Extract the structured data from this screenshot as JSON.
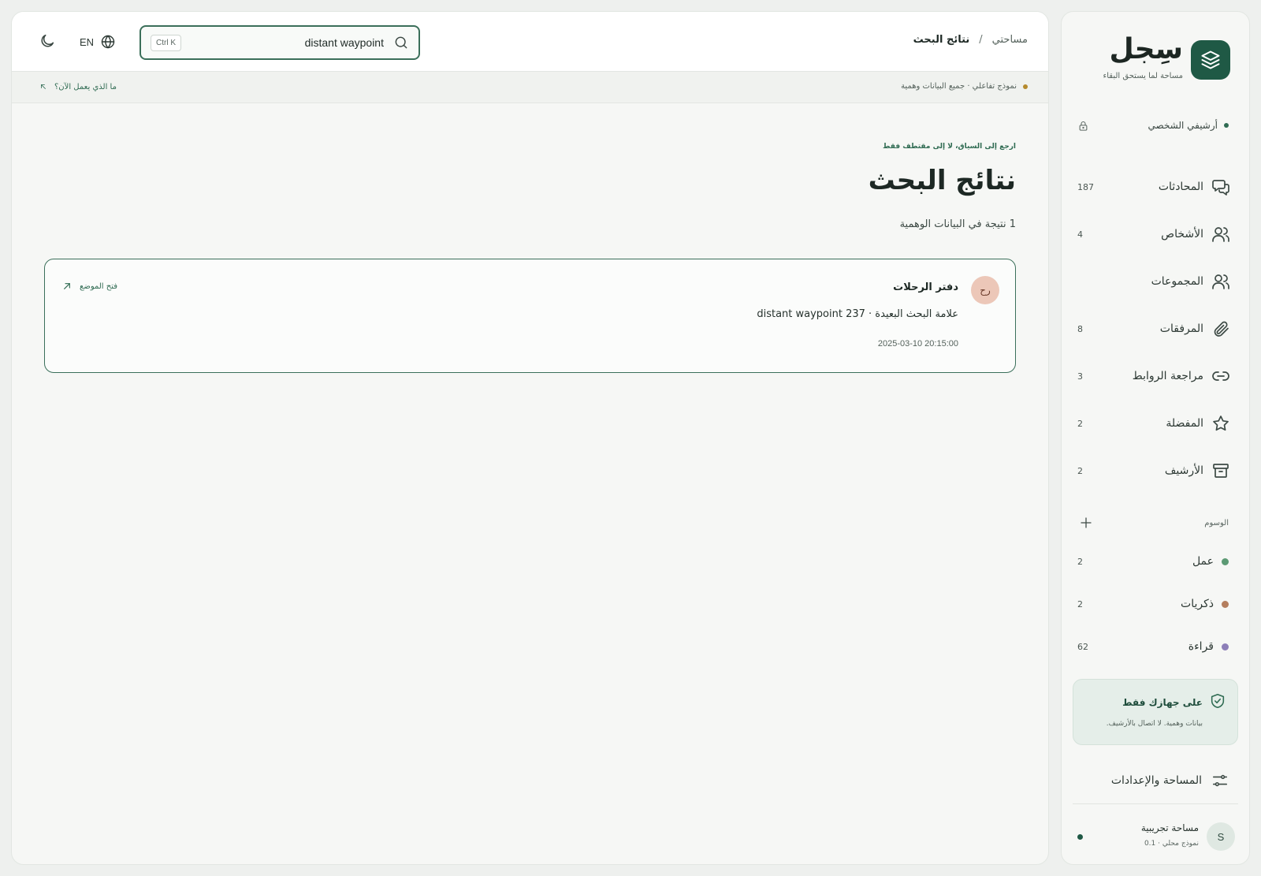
{
  "brand": {
    "name": "سِجل",
    "tagline": "مساحة لما يستحق البقاء"
  },
  "archive": {
    "label": "أرشيفي الشخصي"
  },
  "nav": [
    {
      "label": "المحادثات",
      "count": "187",
      "icon": "chat-icon"
    },
    {
      "label": "الأشخاص",
      "count": "4",
      "icon": "person-icon"
    },
    {
      "label": "المجموعات",
      "count": "",
      "icon": "users-icon"
    },
    {
      "label": "المرفقات",
      "count": "8",
      "icon": "paperclip-icon"
    },
    {
      "label": "مراجعة الروابط",
      "count": "3",
      "icon": "link-icon"
    },
    {
      "label": "المفضلة",
      "count": "2",
      "icon": "star-icon"
    },
    {
      "label": "الأرشيف",
      "count": "2",
      "icon": "archive-box-icon"
    }
  ],
  "tags": {
    "heading": "الوسوم",
    "items": [
      {
        "label": "عمل",
        "count": "2",
        "color": "#5c9a74"
      },
      {
        "label": "ذكريات",
        "count": "2",
        "color": "#b47e5e"
      },
      {
        "label": "قراءة",
        "count": "62",
        "color": "#8d7fb8"
      }
    ]
  },
  "device_card": {
    "title": "على جهازك فقط",
    "subtitle": "بيانات وهمية. لا اتصال بالأرشيف."
  },
  "settings": {
    "label": "المساحة والإعدادات"
  },
  "workspace": {
    "initial": "S",
    "name": "مساحة تجريبية",
    "sub": "نموذج محلي · 0.1"
  },
  "topbar": {
    "breadcrumb_root": "مساحتي",
    "breadcrumb_sep": "/",
    "breadcrumb_current": "نتائج البحث",
    "search_value": "distant waypoint",
    "search_shortcut": "Ctrl K",
    "lang": "EN"
  },
  "notice": {
    "text": "نموذج تفاعلي · جميع البيانات وهمية",
    "link": "ما الذي يعمل الآن؟"
  },
  "results": {
    "context_link": "ارجع إلى السياق، لا إلى مقتطف فقط",
    "title": "نتائج البحث",
    "count_text": "1 نتيجة في البيانات الوهمية",
    "items": [
      {
        "avatar": "رح",
        "title": "دفتر الرحلات",
        "snippet": "علامة البحث البعيدة · distant waypoint 237",
        "date": "2025-03-10 20:15:00",
        "open_label": "فتح الموضع"
      }
    ]
  },
  "colors": {
    "brand": "#1f5945",
    "accent_border": "#3b6f5a",
    "notice_dot": "#b58a2d"
  }
}
